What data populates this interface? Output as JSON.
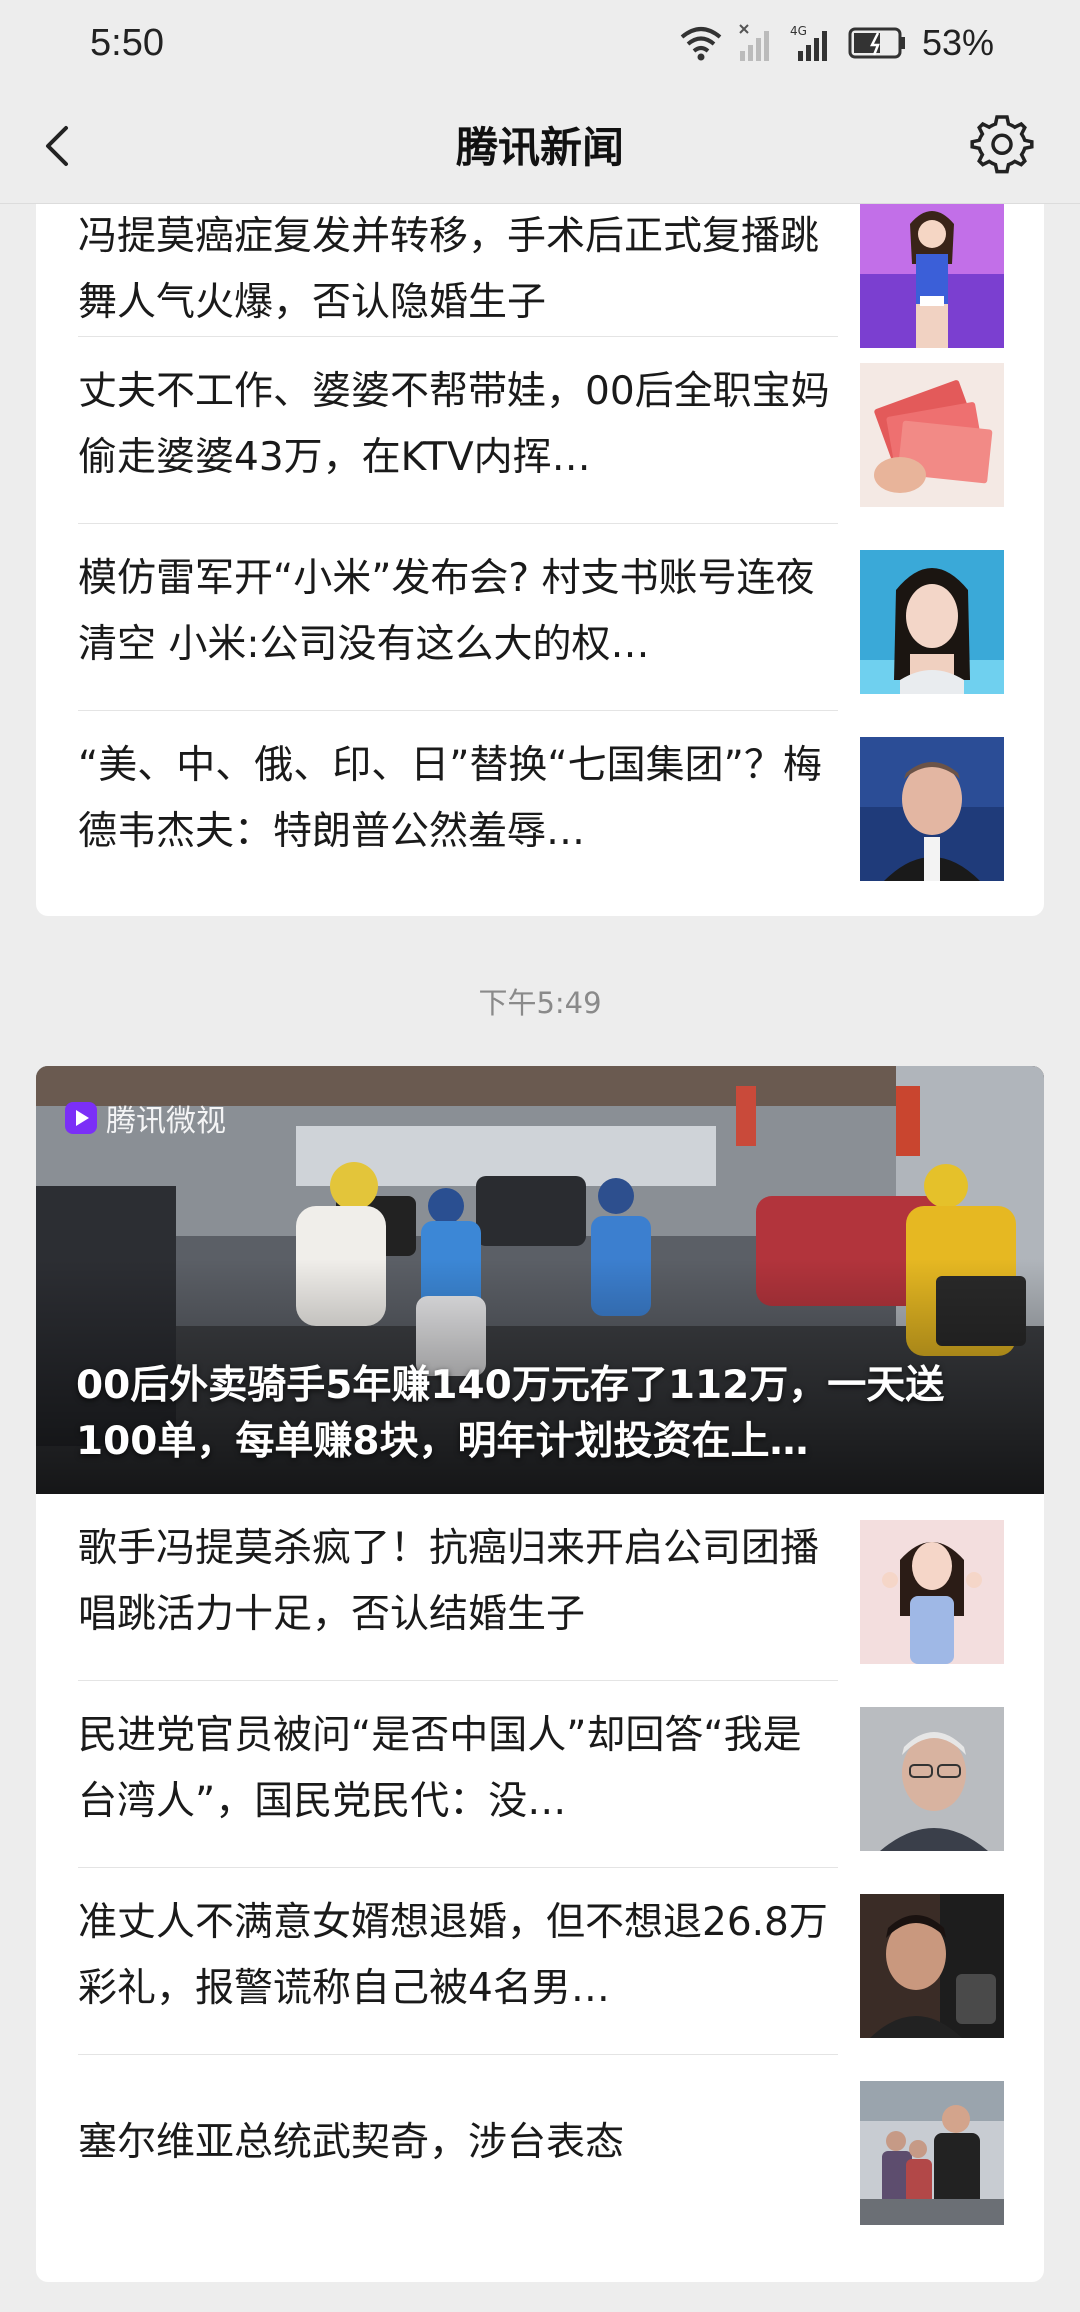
{
  "status_bar": {
    "time": "5:50",
    "network": "4G",
    "battery": "53%"
  },
  "header": {
    "title": "腾讯新闻"
  },
  "card1": {
    "items": [
      {
        "title": "冯提莫癌症复发并转移，手术后正式复播跳舞人气火爆，否认隐婚生子"
      },
      {
        "title": "丈夫不工作、婆婆不帮带娃，00后全职宝妈偷走婆婆43万，在KTV内挥…"
      },
      {
        "title": "模仿雷军开“小米”发布会? 村支书账号连夜清空 小米:公司没有这么大的权…"
      },
      {
        "title": "“美、中、俄、印、日”替换“七国集团”？梅德韦杰夫：特朗普公然羞辱…"
      }
    ]
  },
  "separator": {
    "time": "下午5:49"
  },
  "card2": {
    "featured": {
      "source_logo": "腾讯微视",
      "caption": "00后外卖骑手5年赚140万元存了112万，一天送100单，每单赚8块，明年计划投资在上…"
    },
    "items": [
      {
        "title": "歌手冯提莫杀疯了！抗癌归来开启公司团播唱跳活力十足，否认结婚生子"
      },
      {
        "title": "民进党官员被问“是否中国人”却回答“我是台湾人”，国民党民代：没…"
      },
      {
        "title": "准丈人不满意女婿想退婚，但不想退26.8万彩礼，报警谎称自己被4名男…"
      },
      {
        "title": "塞尔维亚总统武契奇，涉台表态"
      }
    ]
  }
}
